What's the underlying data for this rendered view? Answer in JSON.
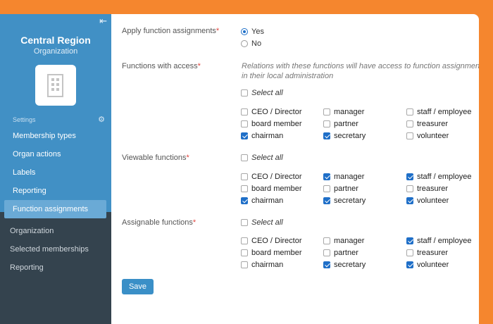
{
  "sidebar": {
    "org_name": "Central Region",
    "org_type": "Organization",
    "section_label": "Settings",
    "menu": [
      {
        "label": "Membership types"
      },
      {
        "label": "Organ actions"
      },
      {
        "label": "Labels"
      },
      {
        "label": "Reporting"
      },
      {
        "label": "Function assignments",
        "active": true
      }
    ],
    "bottom_links": [
      {
        "label": "Organization"
      },
      {
        "label": "Selected memberships"
      },
      {
        "label": "Reporting"
      }
    ]
  },
  "form": {
    "apply": {
      "label": "Apply function assignments",
      "options": [
        {
          "label": "Yes",
          "selected": true
        },
        {
          "label": "No",
          "selected": false
        }
      ]
    },
    "select_all_label": "Select all",
    "sections": [
      {
        "label": "Functions with access",
        "description": "Relations with these functions will have access to function assignments in their local administration",
        "select_all": false,
        "items": [
          {
            "label": "CEO / Director",
            "checked": false
          },
          {
            "label": "manager",
            "checked": false
          },
          {
            "label": "staff / employee",
            "checked": false
          },
          {
            "label": "board member",
            "checked": false
          },
          {
            "label": "partner",
            "checked": false
          },
          {
            "label": "treasurer",
            "checked": false
          },
          {
            "label": "chairman",
            "checked": true
          },
          {
            "label": "secretary",
            "checked": true
          },
          {
            "label": "volunteer",
            "checked": false
          }
        ]
      },
      {
        "label": "Viewable functions",
        "select_all": false,
        "items": [
          {
            "label": "CEO / Director",
            "checked": false
          },
          {
            "label": "manager",
            "checked": true
          },
          {
            "label": "staff / employee",
            "checked": true
          },
          {
            "label": "board member",
            "checked": false
          },
          {
            "label": "partner",
            "checked": false
          },
          {
            "label": "treasurer",
            "checked": false
          },
          {
            "label": "chairman",
            "checked": true
          },
          {
            "label": "secretary",
            "checked": true
          },
          {
            "label": "volunteer",
            "checked": true
          }
        ]
      },
      {
        "label": "Assignable functions",
        "select_all": false,
        "items": [
          {
            "label": "CEO / Director",
            "checked": false
          },
          {
            "label": "manager",
            "checked": false
          },
          {
            "label": "staff / employee",
            "checked": true
          },
          {
            "label": "board member",
            "checked": false
          },
          {
            "label": "partner",
            "checked": false
          },
          {
            "label": "treasurer",
            "checked": false
          },
          {
            "label": "chairman",
            "checked": false
          },
          {
            "label": "secretary",
            "checked": true
          },
          {
            "label": "volunteer",
            "checked": true
          }
        ]
      }
    ],
    "save_label": "Save"
  },
  "colors": {
    "background": "#f5862e",
    "sidebar_top": "#4190c5",
    "sidebar_bottom": "#34434e",
    "accent": "#1f6fc8",
    "required": "#e0443e"
  },
  "icons": [
    "collapse-icon",
    "building-icon",
    "gear-icon"
  ]
}
